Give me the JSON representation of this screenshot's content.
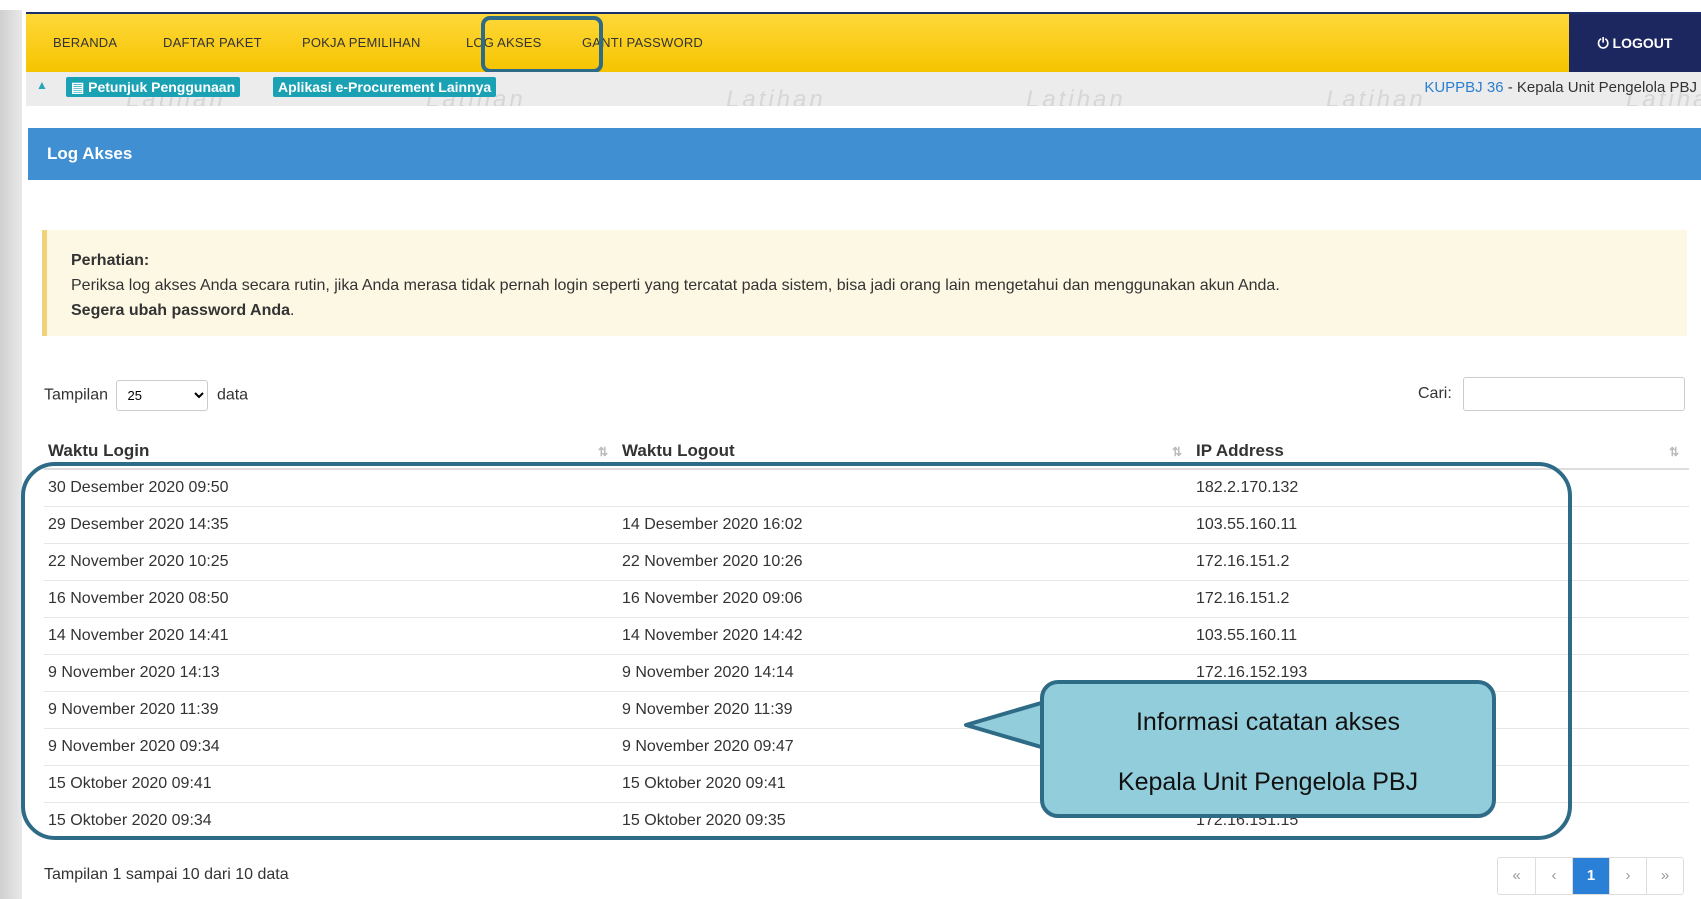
{
  "nav": {
    "items": [
      "BERANDA",
      "DAFTAR PAKET",
      "POKJA PEMILIHAN",
      "LOG AKSES",
      "GANTI PASSWORD"
    ],
    "logout": "LOGOUT"
  },
  "subbar": {
    "help": "Petunjuk Penggunaan",
    "apps": "Aplikasi e-Procurement Lainnya",
    "user_code": "KUPPBJ 36",
    "user_role": " - Kepala Unit Pengelola PBJ",
    "watermark": "Latihan"
  },
  "panel": {
    "title": "Log Akses"
  },
  "alert": {
    "title": "Perhatian:",
    "body": "Periksa log akses Anda secara rutin, jika Anda merasa tidak pernah login seperti yang tercatat pada sistem, bisa jadi orang lain mengetahui dan menggunakan akun Anda.",
    "strong": "Segera ubah password Anda",
    "dot": "."
  },
  "controls": {
    "length_prefix": "Tampilan",
    "length_value": "25",
    "length_suffix": "data",
    "search_label": "Cari:"
  },
  "table": {
    "headers": [
      "Waktu Login",
      "Waktu Logout",
      "IP Address"
    ],
    "rows": [
      [
        "30 Desember 2020 09:50",
        "",
        "182.2.170.132"
      ],
      [
        "29 Desember 2020 14:35",
        "14 Desember 2020 16:02",
        "103.55.160.11"
      ],
      [
        "22 November 2020 10:25",
        "22 November 2020 10:26",
        "172.16.151.2"
      ],
      [
        "16 November 2020 08:50",
        "16 November 2020 09:06",
        "172.16.151.2"
      ],
      [
        "14 November 2020 14:41",
        "14 November 2020 14:42",
        "103.55.160.11"
      ],
      [
        "9 November 2020 14:13",
        "9 November 2020 14:14",
        "172.16.152.193"
      ],
      [
        "9 November 2020 11:39",
        "9 November 2020 11:39",
        ""
      ],
      [
        "9 November 2020 09:34",
        "9 November 2020 09:47",
        ""
      ],
      [
        "15 Oktober 2020 09:41",
        "15 Oktober 2020 09:41",
        ""
      ],
      [
        "15 Oktober 2020 09:34",
        "15 Oktober 2020 09:35",
        "172.16.151.15"
      ]
    ]
  },
  "footer": {
    "info": "Tampilan 1 sampai 10 dari 10 data",
    "pager": [
      "«",
      "‹",
      "1",
      "›",
      "»"
    ]
  },
  "callout": {
    "line1": "Informasi catatan akses",
    "line2": "Kepala Unit Pengelola PBJ"
  },
  "colors": {
    "nav_bg": "#f5c400",
    "logout_bg": "#1c2760",
    "panel_bg": "#3f8fd2",
    "highlight": "#2e6b86",
    "callout_bg": "#92cddb"
  }
}
